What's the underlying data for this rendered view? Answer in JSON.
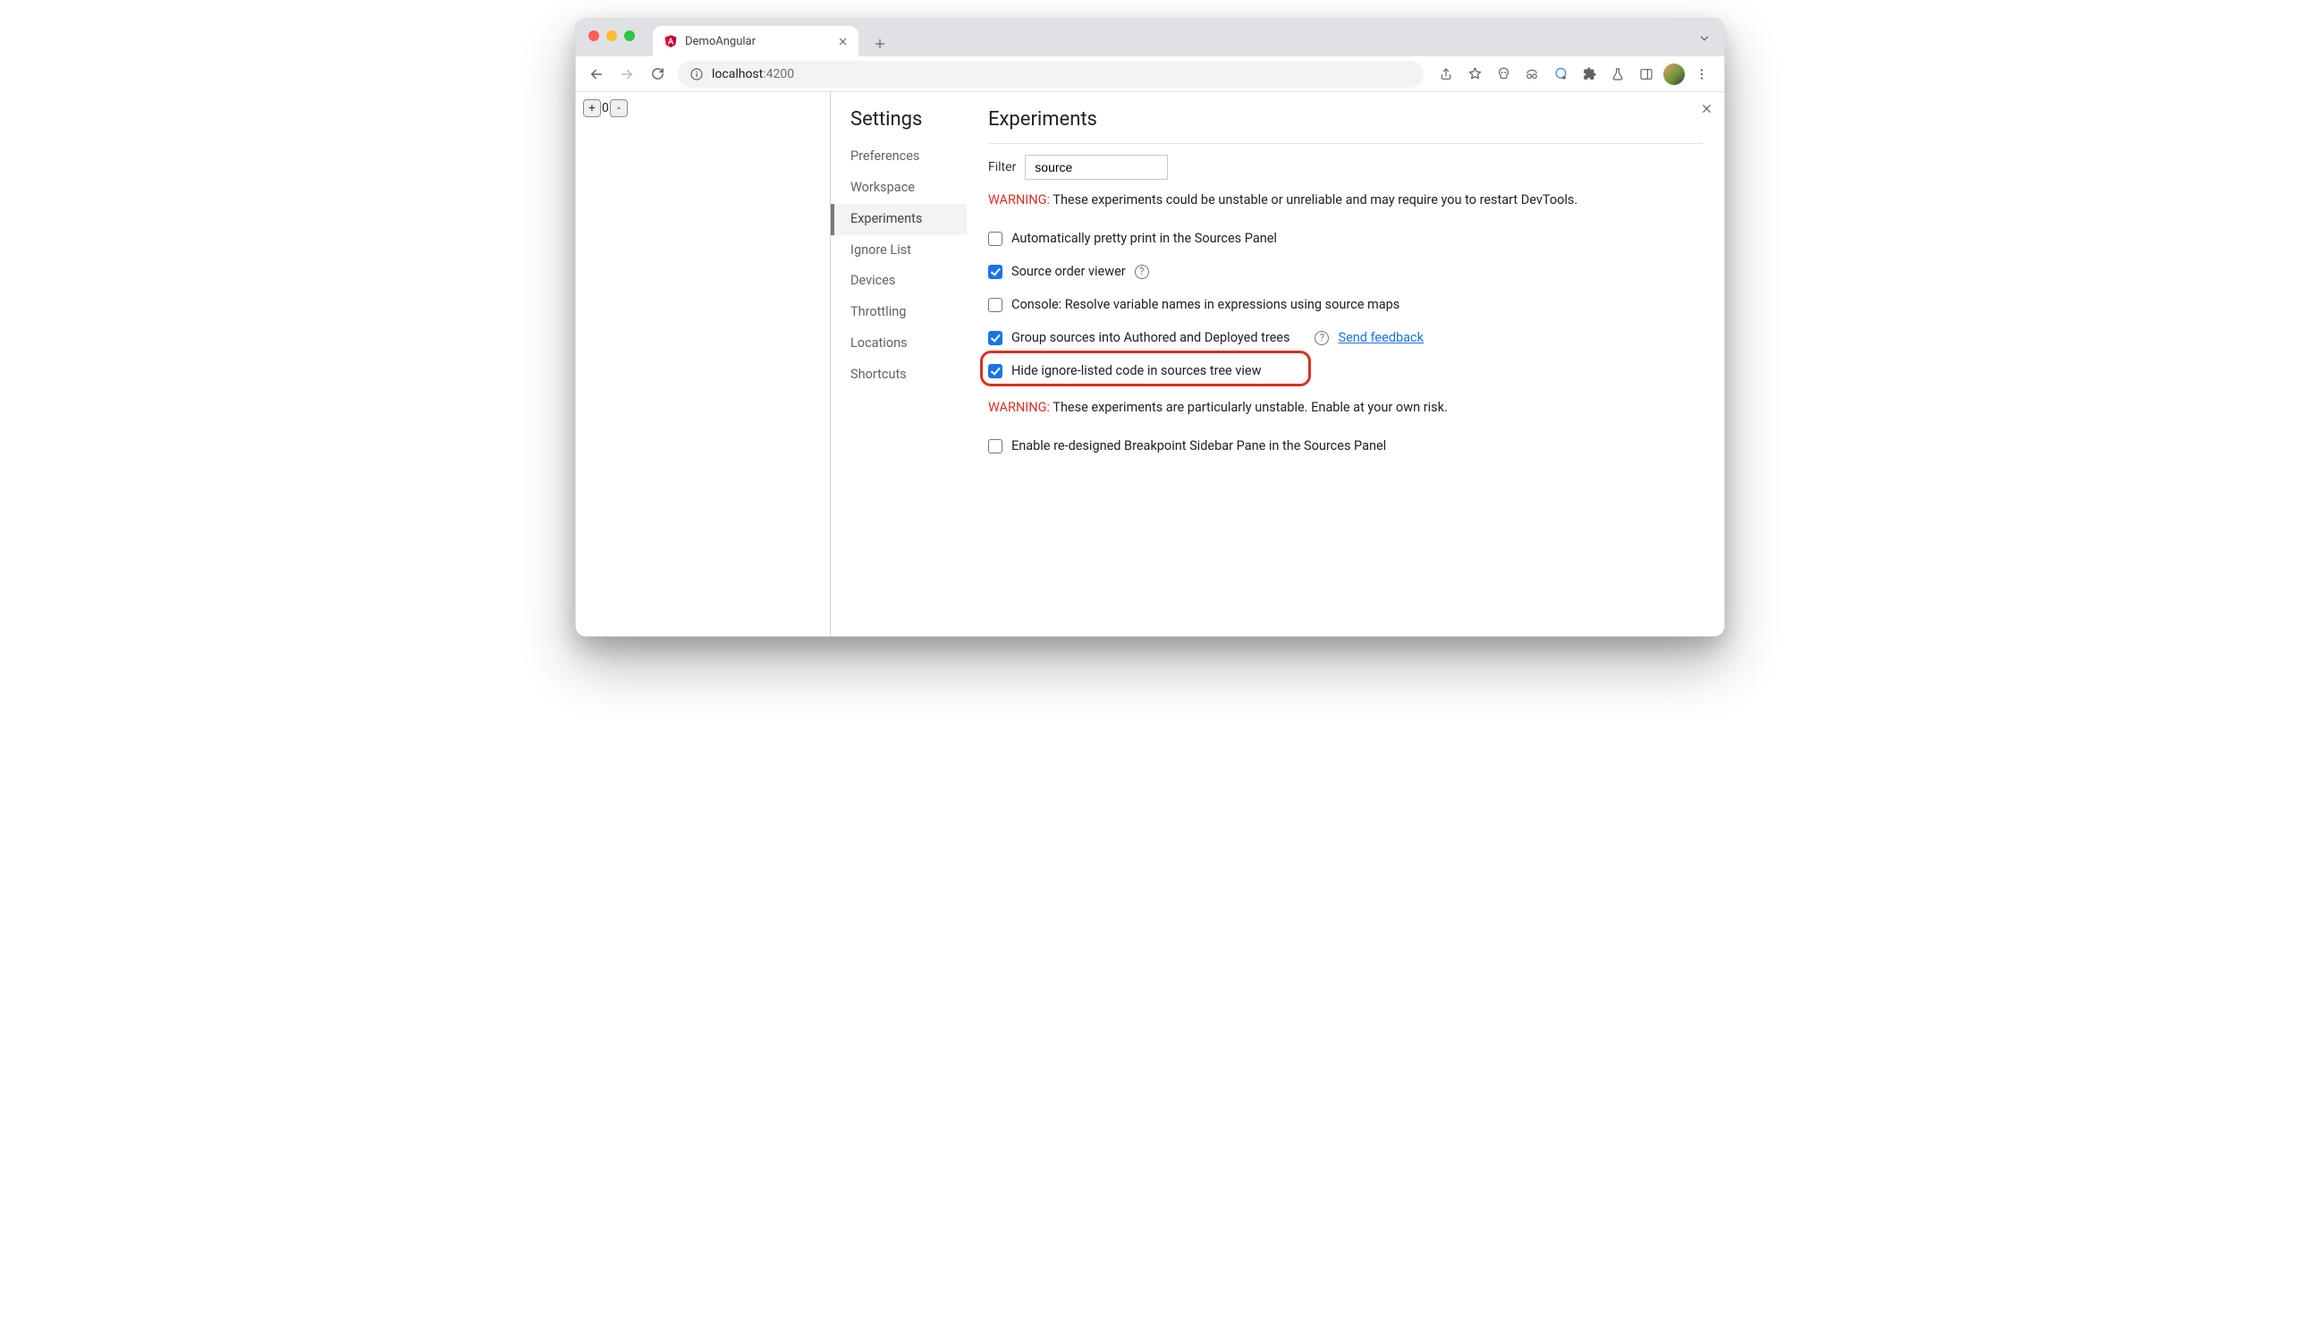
{
  "tab": {
    "title": "DemoAngular"
  },
  "url": {
    "host": "localhost",
    "port": ":4200"
  },
  "page": {
    "counter_value": "0",
    "plus": "+",
    "minus": "-"
  },
  "settings": {
    "title": "Settings",
    "nav": {
      "preferences": "Preferences",
      "workspace": "Workspace",
      "experiments": "Experiments",
      "ignore_list": "Ignore List",
      "devices": "Devices",
      "throttling": "Throttling",
      "locations": "Locations",
      "shortcuts": "Shortcuts"
    }
  },
  "experiments": {
    "title": "Experiments",
    "filter_label": "Filter",
    "filter_value": "source",
    "warning_prefix": "WARNING:",
    "warning1_text": " These experiments could be unstable or unreliable and may require you to restart DevTools.",
    "warning2_text": " These experiments are particularly unstable. Enable at your own risk.",
    "items": {
      "pretty_print": "Automatically pretty print in the Sources Panel",
      "source_order": "Source order viewer",
      "console_resolve": "Console: Resolve variable names in expressions using source maps",
      "group_sources": "Group sources into Authored and Deployed trees",
      "hide_ignore": "Hide ignore-listed code in sources tree view",
      "breakpoint_sidebar": "Enable re-designed Breakpoint Sidebar Pane in the Sources Panel"
    },
    "feedback_link": "Send feedback"
  }
}
